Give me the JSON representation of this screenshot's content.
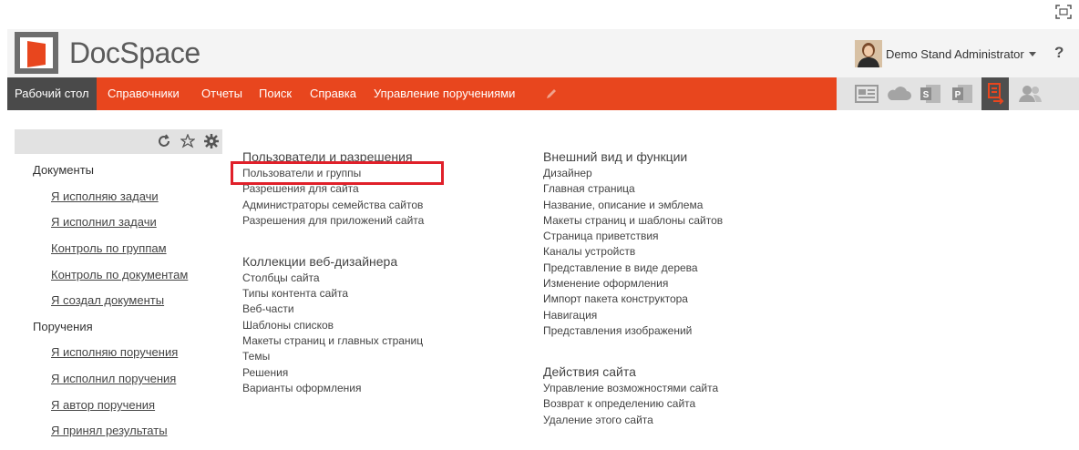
{
  "header": {
    "brand": "DocSpace",
    "user_name": "Demo Stand Administrator",
    "help_label": "?"
  },
  "nav": {
    "items": [
      {
        "label": "Рабочий стол",
        "active": true
      },
      {
        "label": "Справочники"
      },
      {
        "label": "Отчеты"
      },
      {
        "label": "Поиск"
      },
      {
        "label": "Справка"
      },
      {
        "label": "Управление поручениями"
      }
    ]
  },
  "left_panel": {
    "groups": [
      {
        "title": "Документы",
        "links": [
          "Я исполняю задачи",
          "Я исполнил задачи",
          "Контроль по группам",
          "Контроль по документам",
          "Я создал документы"
        ]
      },
      {
        "title": "Поручения",
        "links": [
          "Я исполняю поручения",
          "Я исполнил поручения",
          "Я автор поручения",
          "Я принял результаты"
        ]
      }
    ]
  },
  "settings": {
    "col1": [
      {
        "title": "Пользователи и разрешения",
        "links": [
          "Пользователи и группы",
          "Разрешения для сайта",
          "Администраторы семейства сайтов",
          "Разрешения для приложений сайта"
        ]
      },
      {
        "title": "Коллекции веб-дизайнера",
        "links": [
          "Столбцы сайта",
          "Типы контента сайта",
          "Веб-части",
          "Шаблоны списков",
          "Макеты страниц и главных страниц",
          "Темы",
          "Решения",
          "Варианты оформления"
        ]
      }
    ],
    "col2": [
      {
        "title": "Внешний вид и функции",
        "links": [
          "Дизайнер",
          "Главная страница",
          "Название, описание и эмблема",
          "Макеты страниц и шаблоны сайтов",
          "Страница приветствия",
          "Каналы устройств",
          "Представление в виде дерева",
          "Изменение оформления",
          "Импорт пакета конструктора",
          "Навигация",
          "Представления изображений"
        ]
      },
      {
        "title": "Действия сайта",
        "links": [
          "Управление возможностями сайта",
          "Возврат к определению сайта",
          "Удаление этого сайта"
        ]
      }
    ]
  },
  "colors": {
    "accent": "#e8461e",
    "highlight": "#e0202a",
    "nav_active": "#4a4a4a"
  }
}
